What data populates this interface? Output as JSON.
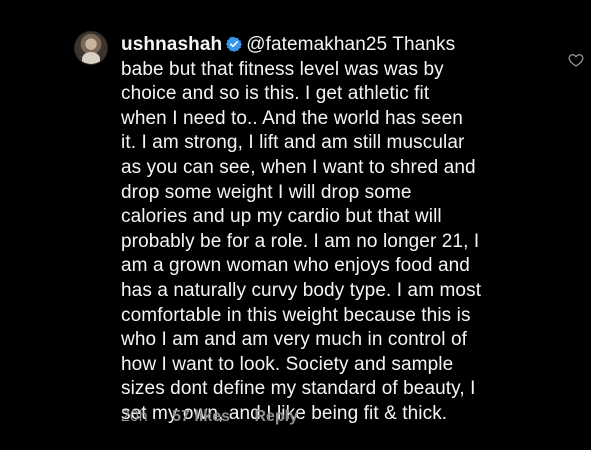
{
  "comment": {
    "username": "ushnashah",
    "mention": "@fatemakhan25",
    "first_line_rest": "Thanks",
    "lines": [
      "babe but that fitness level was was  by",
      "choice and so is this. I get athletic fit",
      "when I need to.. And the world has seen",
      "it. I am strong, I lift and am still muscular",
      "as you can see, when I want to shred and",
      "drop some weight I will drop some",
      "calories and up my cardio but that will",
      "probably be for a role. I am no longer 21, I",
      "am a grown woman who enjoys food and",
      "has a naturally curvy body type. I am most",
      "comfortable in this weight because this is",
      "who I am and am very much in control of",
      "how I want to look. Society and sample",
      "sizes dont define my standard of beauty, I",
      "set my own, and I like being fit & thick."
    ],
    "time": "20h",
    "likes": "57 likes",
    "reply_label": "Reply"
  },
  "icons": {
    "verified": "verified-badge-icon",
    "like": "heart-icon"
  },
  "colors": {
    "background": "#000000",
    "text": "#f5f5f5",
    "meta": "#8e8e8e",
    "verified": "#3897f0"
  }
}
